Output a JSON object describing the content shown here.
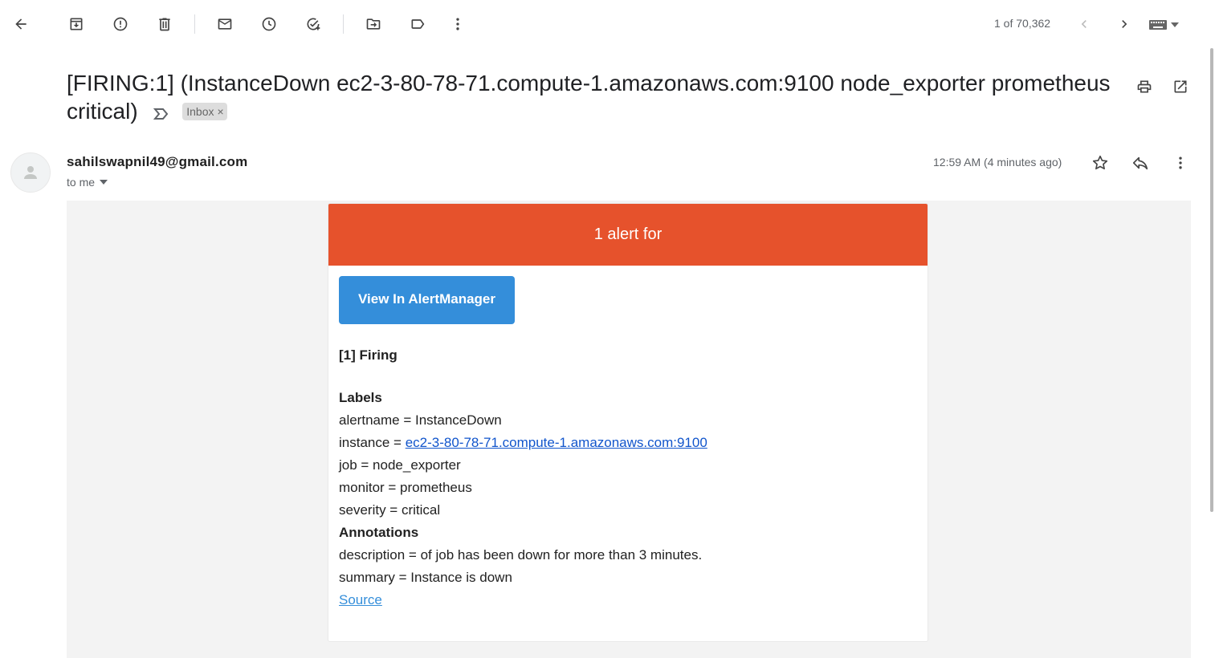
{
  "toolbar": {
    "back_icon": "arrow-back-icon",
    "buttons": [
      {
        "name": "archive-button",
        "icon": "archive-icon"
      },
      {
        "name": "report-spam-button",
        "icon": "report-icon"
      },
      {
        "name": "delete-button",
        "icon": "trash-icon"
      },
      {
        "name": "mark-unread-button",
        "icon": "mail-icon"
      },
      {
        "name": "snooze-button",
        "icon": "clock-icon"
      },
      {
        "name": "add-task-button",
        "icon": "task-add-icon"
      },
      {
        "name": "move-to-button",
        "icon": "folder-move-icon"
      },
      {
        "name": "labels-button",
        "icon": "label-icon"
      },
      {
        "name": "more-button",
        "icon": "more-vert-icon"
      }
    ],
    "pager_text": "1 of 70,362"
  },
  "email": {
    "subject": "[FIRING:1] (InstanceDown ec2-3-80-78-71.compute-1.amazonaws.com:9100 node_exporter prometheus critical)",
    "label_chip": "Inbox",
    "label_chip_close": "×",
    "sender": "sahilswapnil49@gmail.com",
    "recipient_text": "to me",
    "time": "12:59 AM (4 minutes ago)"
  },
  "alert": {
    "header": "1 alert for",
    "button_label": "View In AlertManager",
    "firing_title": "[1] Firing",
    "labels_title": "Labels",
    "labels": {
      "alertname": "alertname = InstanceDown",
      "instance_prefix": "instance = ",
      "instance_link": "ec2-3-80-78-71.compute-1.amazonaws.com:9100",
      "job": "job = node_exporter",
      "monitor": "monitor = prometheus",
      "severity": "severity = critical"
    },
    "annotations_title": "Annotations",
    "annotations": {
      "description": "description = of job has been down for more than 3 minutes.",
      "summary": "summary = Instance is down"
    },
    "source_link": "Source"
  },
  "colors": {
    "header_bg": "#e6522c",
    "button_bg": "#348eda",
    "link": "#1155cc",
    "body_bg": "#f3f3f3"
  }
}
